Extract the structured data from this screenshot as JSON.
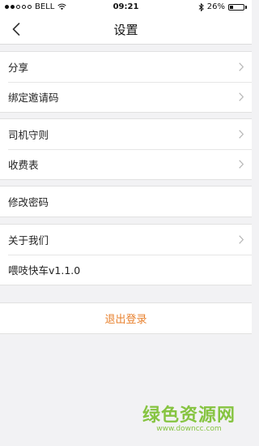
{
  "status_bar": {
    "carrier": "BELL",
    "time": "09:21",
    "battery": "26%",
    "battery_level": 0.26
  },
  "nav": {
    "title": "设置",
    "back_icon": "chevron-left-icon"
  },
  "groups": [
    {
      "items": [
        {
          "label": "分享",
          "chevron": true
        },
        {
          "label": "绑定邀请码",
          "chevron": true
        }
      ]
    },
    {
      "items": [
        {
          "label": "司机守则",
          "chevron": true
        },
        {
          "label": "收费表",
          "chevron": true
        }
      ]
    },
    {
      "items": [
        {
          "label": "修改密码",
          "chevron": false
        }
      ]
    },
    {
      "items": [
        {
          "label": "关于我们",
          "chevron": true
        },
        {
          "label": "喂吱快车v1.1.0",
          "chevron": false
        }
      ]
    }
  ],
  "logout_label": "退出登录",
  "watermark": {
    "main": "绿色资源网",
    "sub": "www.downcc.com"
  },
  "colors": {
    "accent": "#e8812e",
    "background": "#f2f2f4",
    "watermark": "#86c441"
  }
}
